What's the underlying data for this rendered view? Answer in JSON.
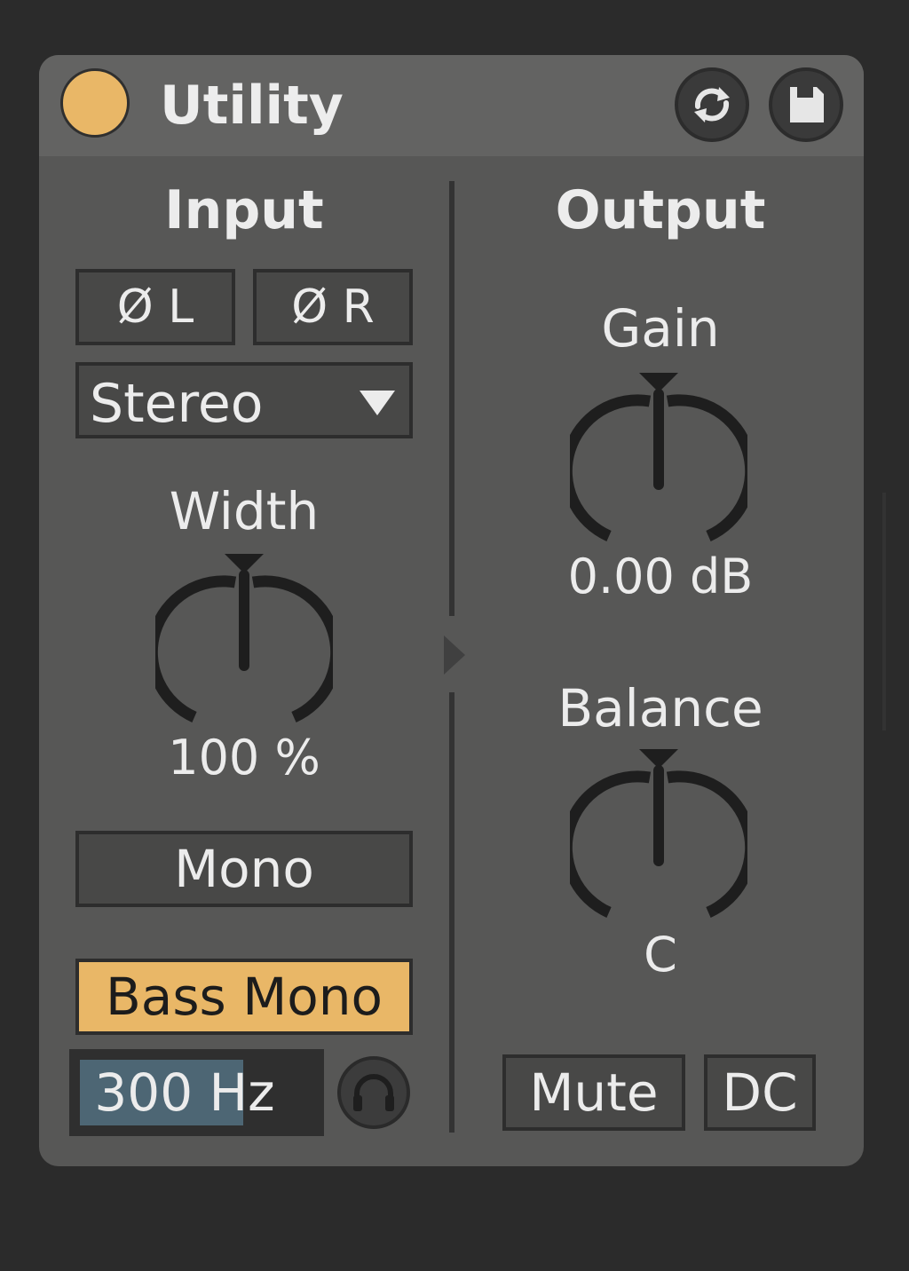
{
  "device": {
    "title": "Utility",
    "power_on": true
  },
  "input": {
    "title": "Input",
    "phase_left": "Ø L",
    "phase_right": "Ø R",
    "channel_mode": "Stereo",
    "width": {
      "label": "Width",
      "value": "100 %"
    },
    "mono_label": "Mono",
    "bass_mono_label": "Bass Mono",
    "bass_mono_active": true,
    "bass_mono_freq": "300 Hz",
    "bass_mono_freq_fill_fraction": 0.7
  },
  "output": {
    "title": "Output",
    "gain": {
      "label": "Gain",
      "value": "0.00 dB"
    },
    "balance": {
      "label": "Balance",
      "value": "C"
    },
    "mute_label": "Mute",
    "dc_label": "DC"
  },
  "colors": {
    "accent": "#e9b767",
    "panel": "#575756",
    "freq_fill": "#4d6674"
  },
  "icons": {
    "power": "power-icon",
    "hot_swap": "hot-swap-icon",
    "save": "save-icon",
    "headphone": "headphone-icon",
    "dropdown": "chevron-down-icon"
  }
}
